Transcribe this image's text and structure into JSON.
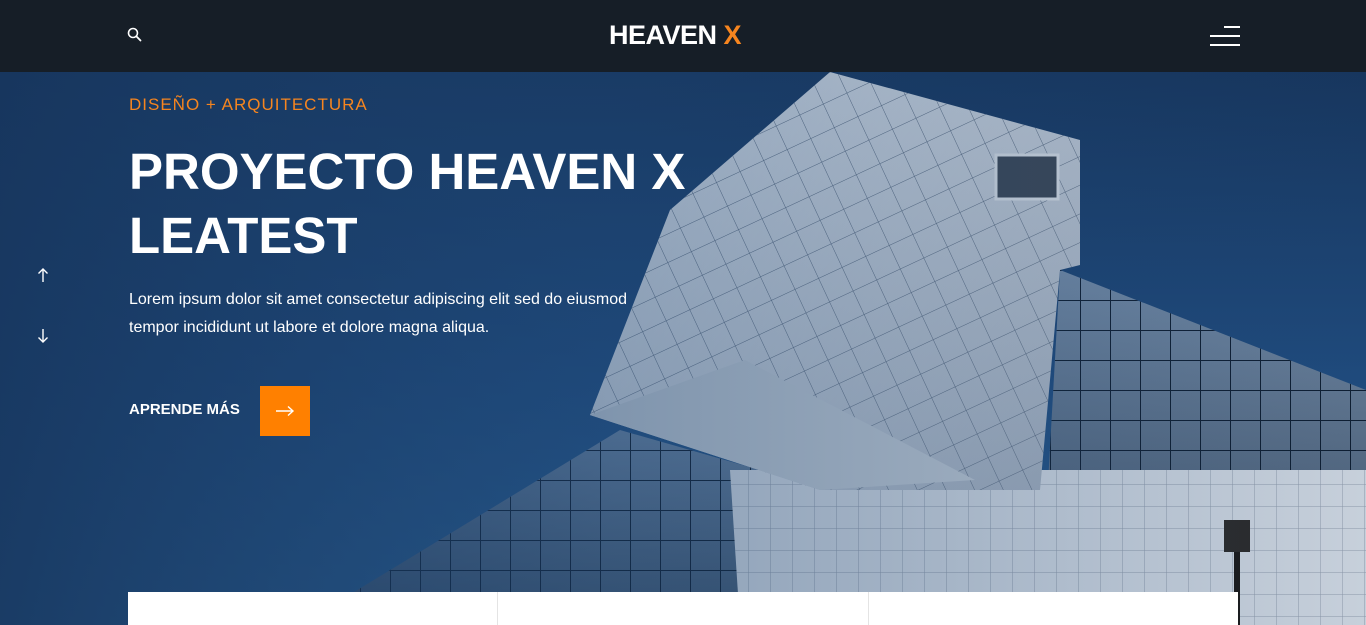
{
  "header": {
    "logo_main": "HEAVEN",
    "logo_accent": "X"
  },
  "hero": {
    "kicker": "DISEÑO + ARQUITECTURA",
    "title": "PROYECTO HEAVEN X LEATEST",
    "description": "Lorem ipsum dolor sit amet consectetur adipiscing elit sed do eiusmod tempor incididunt ut labore et dolore magna aliqua.",
    "cta_label": "APRENDE MÁS"
  },
  "colors": {
    "accent": "#ff8000",
    "header_bg": "#161e27"
  },
  "icons": [
    "search-icon",
    "menu-icon",
    "arrow-right-icon",
    "arrow-up-icon",
    "arrow-down-icon"
  ]
}
